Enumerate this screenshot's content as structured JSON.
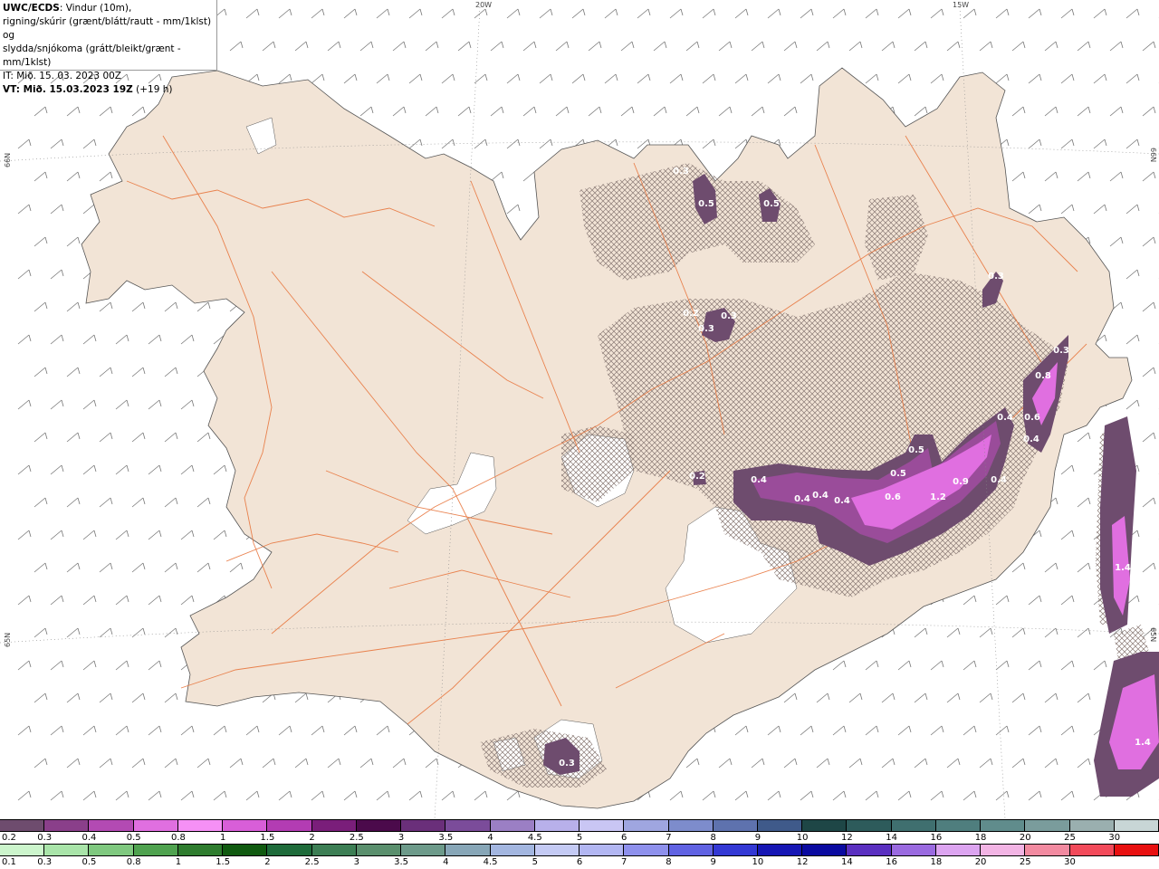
{
  "header": {
    "product": "UWC/ECDS",
    "line1_rest": ": Vindur (10m),",
    "line2": "rigning/skúrir (grænt/blátt/rautt - mm/1klst) og",
    "line3": "slydda/snjókoma (grátt/bleikt/grænt - mm/1klst)",
    "it_line": "IT: Mið. 15. 03. 2023 00Z",
    "vt_label": "VT: Mið. 15.03.2023 19Z",
    "vt_offset": " (+19 h)"
  },
  "graticule": {
    "lon_20w": "20W",
    "lon_15w": "15W",
    "lat_66n_left": "66N",
    "lat_66n_right": "66N",
    "lat_65n_left": "65N",
    "lat_65n_right": "65N"
  },
  "precip_labels": [
    {
      "text": "0.3",
      "lon": "",
      "v": 0.3
    },
    {
      "text": "0.5",
      "v": 0.5
    },
    {
      "text": "0.5",
      "v": 0.5
    },
    {
      "text": "0.2",
      "v": 0.2
    },
    {
      "text": "0.3",
      "v": 0.3
    },
    {
      "text": "0.3",
      "v": 0.3
    },
    {
      "text": "0.3",
      "v": 0.3
    },
    {
      "text": "0.8",
      "v": 0.8
    },
    {
      "text": "0.4",
      "v": 0.4
    },
    {
      "text": "0.6",
      "v": 0.6
    },
    {
      "text": "0.4",
      "v": 0.4
    },
    {
      "text": "0.3",
      "v": 0.3
    },
    {
      "text": "0.5",
      "v": 0.5
    },
    {
      "text": "0.5",
      "v": 0.5
    },
    {
      "text": "0.9",
      "v": 0.9
    },
    {
      "text": "0.4",
      "v": 0.4
    },
    {
      "text": "0.2",
      "v": 0.2
    },
    {
      "text": "0.4",
      "v": 0.4
    },
    {
      "text": "0.4",
      "v": 0.4
    },
    {
      "text": "0.4",
      "v": 0.4
    },
    {
      "text": "0.4",
      "v": 0.4
    },
    {
      "text": "0.6",
      "v": 0.6
    },
    {
      "text": "1.2",
      "v": 1.2
    },
    {
      "text": "1.4",
      "v": 1.4
    },
    {
      "text": "1.4",
      "v": 1.4
    },
    {
      "text": "0.3",
      "v": 0.3
    }
  ],
  "legend_snow": {
    "labels": [
      "0.2",
      "0.3",
      "0.4",
      "0.5",
      "0.8",
      "1",
      "1.5",
      "2",
      "2.5",
      "3",
      "3.5",
      "4",
      "4.5",
      "5",
      "6",
      "7",
      "8",
      "9",
      "10",
      "12",
      "14",
      "16",
      "18",
      "20",
      "25",
      "30"
    ],
    "colors": [
      "#6e4c6e",
      "#8a3f8a",
      "#b34ab3",
      "#e06fe0",
      "#f590f5",
      "#d85ed8",
      "#b33cb3",
      "#7a1e7a",
      "#4b0a4b",
      "#6a2f7a",
      "#7b4c9a",
      "#9b7fc4",
      "#b8b0ea",
      "#c9c6f4",
      "#9fa6e0",
      "#7d8ccc",
      "#5e72ae",
      "#3f5a8a",
      "#1e4646",
      "#2d5b5b",
      "#3f6f6f",
      "#4f7e7e",
      "#608c8c",
      "#7a9c9c",
      "#9aafaf",
      "#c8d6d6"
    ]
  },
  "legend_rain": {
    "labels": [
      "0.1",
      "0.3",
      "0.5",
      "0.8",
      "1",
      "1.5",
      "2",
      "2.5",
      "3",
      "3.5",
      "4",
      "4.5",
      "5",
      "6",
      "7",
      "8",
      "9",
      "10",
      "12",
      "14",
      "16",
      "18",
      "20",
      "25",
      "30"
    ],
    "colors": [
      "#ccf5cc",
      "#a9e4a9",
      "#7fc87f",
      "#4fa24f",
      "#2e7c2e",
      "#105a10",
      "#1e6b3a",
      "#3c7e54",
      "#5a8f6d",
      "#6d9a8a",
      "#87a6b7",
      "#a3b6e0",
      "#c4caf4",
      "#b2b6f2",
      "#8e90ec",
      "#6062e2",
      "#3338d4",
      "#1616b4",
      "#0a0aa0",
      "#5a2fc0",
      "#9a6ae0",
      "#dca4f0",
      "#f2b4e4",
      "#f28aa0",
      "#f24a5a",
      "#e81010"
    ]
  }
}
